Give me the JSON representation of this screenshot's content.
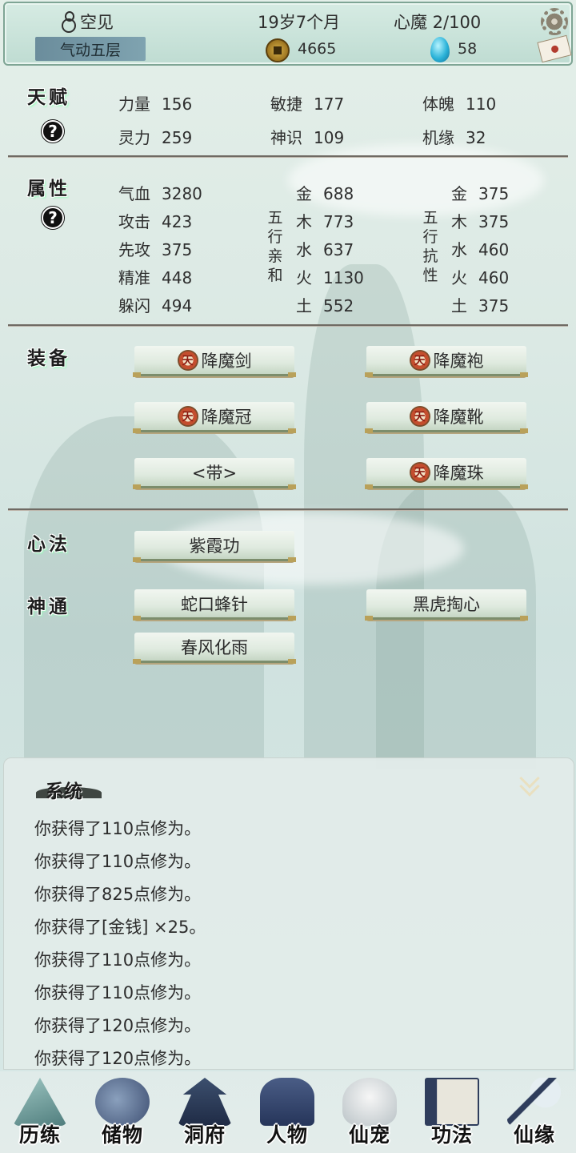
{
  "header": {
    "name": "空见",
    "realm": "气动五层",
    "age": "19岁7个月",
    "inner_demon": "心魔 2/100",
    "coins": "4665",
    "gems": "58"
  },
  "talent": {
    "title": "天赋",
    "stats": [
      {
        "k": "力量",
        "v": "156"
      },
      {
        "k": "敏捷",
        "v": "177"
      },
      {
        "k": "体魄",
        "v": "110"
      },
      {
        "k": "灵力",
        "v": "259"
      },
      {
        "k": "神识",
        "v": "109"
      },
      {
        "k": "机缘",
        "v": "32"
      }
    ]
  },
  "attributes": {
    "title": "属性",
    "basic": [
      {
        "k": "气血",
        "v": "3280"
      },
      {
        "k": "攻击",
        "v": "423"
      },
      {
        "k": "先攻",
        "v": "375"
      },
      {
        "k": "精准",
        "v": "448"
      },
      {
        "k": "躲闪",
        "v": "494"
      }
    ],
    "affinity_label": "五行亲和",
    "affinity": [
      {
        "k": "金",
        "v": "688"
      },
      {
        "k": "木",
        "v": "773"
      },
      {
        "k": "水",
        "v": "637"
      },
      {
        "k": "火",
        "v": "1130"
      },
      {
        "k": "土",
        "v": "552"
      }
    ],
    "resist_label": "五行抗性",
    "resist": [
      {
        "k": "金",
        "v": "375"
      },
      {
        "k": "木",
        "v": "375"
      },
      {
        "k": "水",
        "v": "460"
      },
      {
        "k": "火",
        "v": "460"
      },
      {
        "k": "土",
        "v": "375"
      }
    ]
  },
  "equipment": {
    "title": "装备",
    "rank_glyph": "天",
    "items": [
      "降魔剑",
      "降魔袍",
      "降魔冠",
      "降魔靴",
      "<带>",
      "降魔珠"
    ]
  },
  "mind_method": {
    "title": "心法",
    "items": [
      "紫霞功"
    ]
  },
  "abilities": {
    "title": "神通",
    "items": [
      "蛇口蜂针",
      "黑虎掏心",
      "春风化雨"
    ]
  },
  "log": {
    "title": "系统",
    "lines": [
      "你获得了110点修为。",
      "你获得了110点修为。",
      "你获得了825点修为。",
      "你获得了[金钱] ×25。",
      "你获得了110点修为。",
      "你获得了110点修为。",
      "你获得了120点修为。",
      "你获得了120点修为。"
    ]
  },
  "nav": [
    "历练",
    "储物",
    "洞府",
    "人物",
    "仙宠",
    "功法",
    "仙缘"
  ],
  "icons": {
    "name": "gourd-icon",
    "coins": "coin-icon",
    "gems": "spirit-stone-icon",
    "settings": "gear-icon",
    "mail": "mail-icon",
    "help": "question-icon",
    "collapse": "double-chevron-down-icon"
  },
  "colors": {
    "panel_bg": "#d6ebe3",
    "realm_badge": "#6b8d9c",
    "divider": "#6f6a63"
  }
}
